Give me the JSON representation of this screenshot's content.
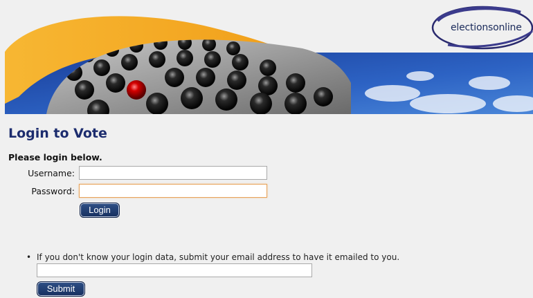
{
  "header": {
    "logo_text": "electionsonline"
  },
  "main": {
    "title": "Login to Vote",
    "subtitle": "Please login below.",
    "username_label": "Username:",
    "username_value": "",
    "password_label": "Password:",
    "password_value": "",
    "login_button": "Login",
    "hint_text": "If you don't know your login data, submit your email address to have it emailed to you.",
    "email_value": "",
    "submit_button": "Submit"
  },
  "colors": {
    "title": "#1c2c6e",
    "button": "#1e3a6e",
    "banner_blue": "#1f4aa8",
    "swoosh": "#f5a623",
    "focus_border": "#e8a35c"
  }
}
